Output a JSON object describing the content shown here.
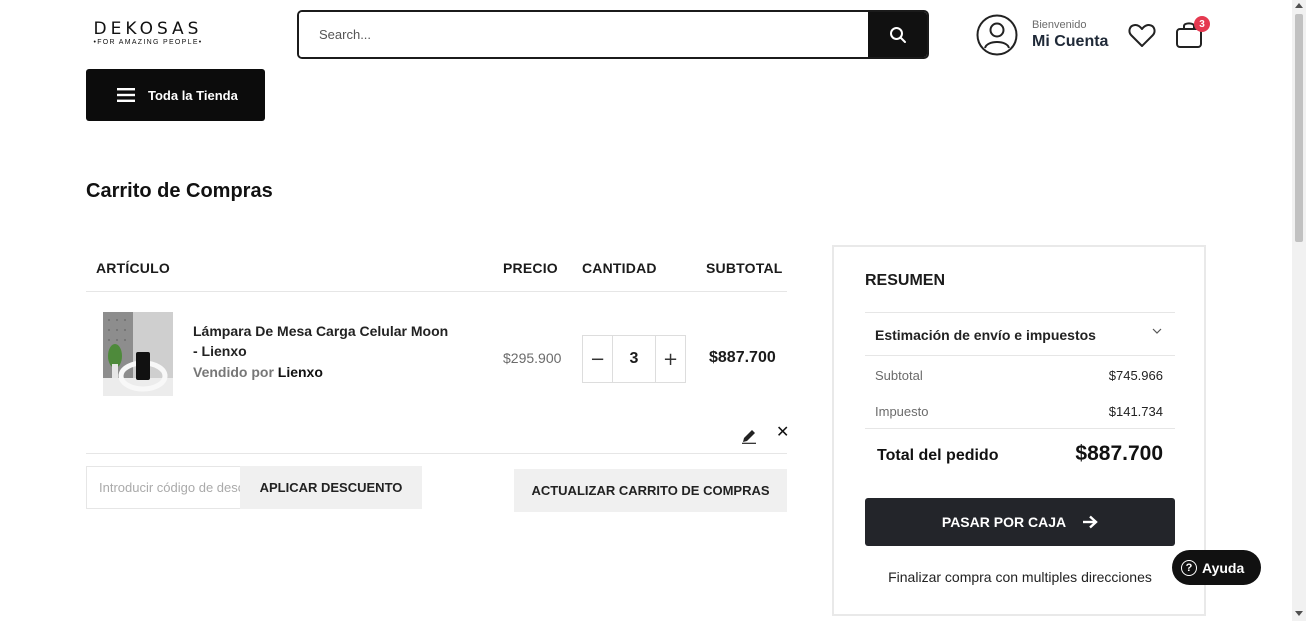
{
  "header": {
    "logo_main": "DEKOSAS",
    "logo_sub": "•FOR AMAZING PEOPLE•",
    "search_placeholder": "Search...",
    "account_welcome": "Bienvenido",
    "account_name": "Mi Cuenta",
    "cart_count": "3",
    "all_store_label": "Toda la Tienda"
  },
  "page": {
    "title": "Carrito de Compras"
  },
  "cart": {
    "columns": {
      "item": "ARTÍCULO",
      "price": "PRECIO",
      "quantity": "CANTIDAD",
      "subtotal": "SUBTOTAL"
    },
    "items": [
      {
        "name": "Lámpara De Mesa Carga Celular Moon - Lienxo",
        "sold_by_label": "Vendido por",
        "seller": "Lienxo",
        "price": "$295.900",
        "qty_decrement": "−",
        "quantity": "3",
        "qty_increment": "+",
        "subtotal": "$887.700"
      }
    ],
    "coupon_placeholder": "Introducir código de descuento",
    "apply_discount_label": "APLICAR DESCUENTO",
    "update_cart_label": "ACTUALIZAR CARRITO DE COMPRAS"
  },
  "summary": {
    "title": "RESUMEN",
    "shipping_estimate_label": "Estimación de envío e impuestos",
    "subtotal_label": "Subtotal",
    "subtotal_value": "$745.966",
    "tax_label": "Impuesto",
    "tax_value": "$141.734",
    "total_label": "Total del pedido",
    "total_value": "$887.700",
    "checkout_label": "PASAR POR CAJA",
    "multi_address_label": "Finalizar compra con multiples direcciones"
  },
  "help": {
    "icon_text": "?",
    "label": "Ayuda"
  },
  "colors": {
    "accent_dark": "#23252a",
    "badge": "#e53950"
  },
  "icons": [
    "search-icon",
    "user-icon",
    "heart-icon",
    "cart-icon",
    "menu-icon",
    "edit-icon",
    "close-icon",
    "chevron-down-icon",
    "arrow-right-icon",
    "help-icon"
  ]
}
